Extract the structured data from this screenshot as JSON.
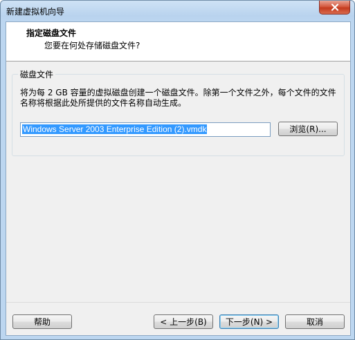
{
  "window": {
    "title": "新建虚拟机向导"
  },
  "header": {
    "title": "指定磁盘文件",
    "subtitle": "您要在何处存储磁盘文件?"
  },
  "disk_group": {
    "label": "磁盘文件",
    "description": "将为每 2 GB 容量的虚拟磁盘创建一个磁盘文件。除第一个文件之外，每个文件的文件名称将根据此处所提供的文件名称自动生成。",
    "file_name": "Windows Server 2003 Enterprise Edition (2).vmdk",
    "browse_label": "浏览(R)..."
  },
  "footer": {
    "help_label": "帮助",
    "back_label": "< 上一步(B)",
    "next_label": "下一步(N) >",
    "cancel_label": "取消"
  },
  "colors": {
    "selection": "#3399ff",
    "close_button": "#c43a1e",
    "title_bar": "#b9d3ee"
  }
}
